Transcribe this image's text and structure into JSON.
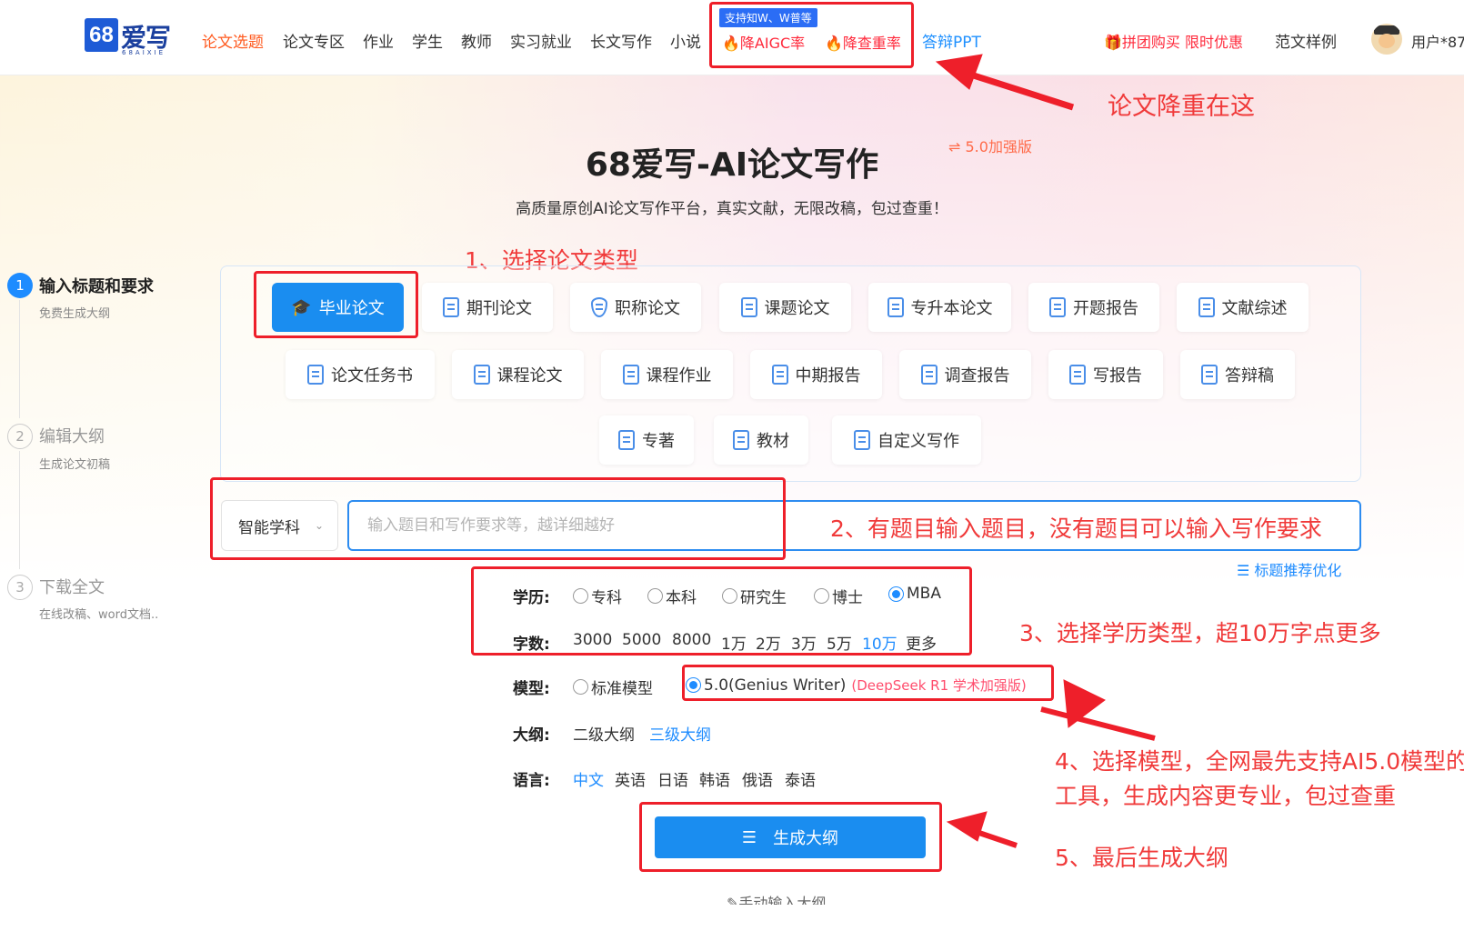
{
  "header": {
    "logo_text": "爱写",
    "logo_number": "68",
    "logo_sub": "68AIXIE",
    "nav": [
      "论文选题",
      "论文专区",
      "作业",
      "学生",
      "教师",
      "实习就业",
      "长文写作",
      "小说"
    ],
    "badge": "支持知W、W普等",
    "hot1": "降AIGC率",
    "hot2": "降查重率",
    "ppt": "答辩PPT",
    "promo": "拼团购买 限时优惠",
    "samples": "范文样例",
    "user": "用户*87"
  },
  "hero": {
    "title": "68爱写-AI论文写作",
    "version": "⇌ 5.0加强版",
    "subtitle": "高质量原创AI论文写作平台，真实文献，无限改稿，包过查重！"
  },
  "steps": [
    {
      "num": "1",
      "title": "输入标题和要求",
      "desc": "免费生成大纲"
    },
    {
      "num": "2",
      "title": "编辑大纲",
      "desc": "生成论文初稿"
    },
    {
      "num": "3",
      "title": "下载全文",
      "desc": "在线改稿、word文档.."
    }
  ],
  "types": [
    "毕业论文",
    "期刊论文",
    "职称论文",
    "课题论文",
    "专升本论文",
    "开题报告",
    "文献综述",
    "论文任务书",
    "课程论文",
    "课程作业",
    "中期报告",
    "调查报告",
    "写报告",
    "答辩稿",
    "专著",
    "教材",
    "自定义写作"
  ],
  "form": {
    "subject": "智能学科",
    "topic_placeholder": "输入题目和写作要求等，越详细越好",
    "optimize": "☰ 标题推荐优化",
    "edu_label": "学历:",
    "edu_options": [
      "专科",
      "本科",
      "研究生",
      "博士",
      "MBA"
    ],
    "words_label": "字数:",
    "words_options": [
      "3000",
      "5000",
      "8000",
      "1万",
      "2万",
      "3万",
      "5万",
      "10万",
      "更多"
    ],
    "model_label": "模型:",
    "model_std": "标准模型",
    "model_pro": "5.0(Genius Writer)",
    "model_pro_note": "(DeepSeek R1 学术加强版)",
    "outline_label": "大纲:",
    "outline_options": [
      "二级大纲",
      "三级大纲"
    ],
    "lang_label": "语言:",
    "lang_options": [
      "中文",
      "英语",
      "日语",
      "韩语",
      "俄语",
      "泰语"
    ],
    "generate": "生成大纲",
    "manual": "手动输入大纲"
  },
  "annotations": {
    "a0": "论文降重在这",
    "a1": "1、选择论文类型",
    "a2": "2、有题目输入题目，没有题目可以输入写作要求",
    "a3": "3、选择学历类型，超10万字点更多",
    "a4_line1": "4、选择模型，全网最先支持AI5.0模型的",
    "a4_line2": "工具，生成内容更专业，包过查重",
    "a5": "5、最后生成大纲"
  },
  "colors": {
    "accent": "#1a8df0",
    "annotation": "#ee1f2a",
    "hot": "#ff2a3c",
    "active_nav": "#ff5a1f"
  }
}
